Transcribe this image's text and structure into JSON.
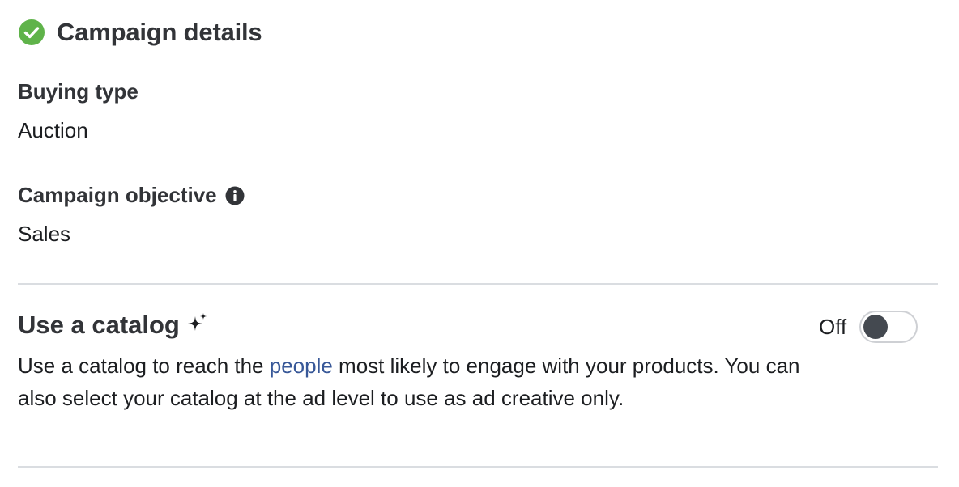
{
  "header": {
    "title": "Campaign details",
    "status_icon": "check-circle-icon",
    "status_color": "#5fb34a"
  },
  "buying_type": {
    "label": "Buying type",
    "value": "Auction"
  },
  "campaign_objective": {
    "label": "Campaign objective",
    "info_icon": "info-icon",
    "value": "Sales"
  },
  "catalog": {
    "title": "Use a catalog",
    "title_icon": "sparkle-icon",
    "toggle_label": "Off",
    "toggle_state": "off",
    "desc_before": "Use a catalog to reach the ",
    "desc_link": "people",
    "desc_after": " most likely to engage with your products. You can also select your catalog at the ad level to use as ad creative only."
  },
  "colors": {
    "link": "#385898",
    "divider": "#dadde1",
    "knob": "#444950"
  }
}
